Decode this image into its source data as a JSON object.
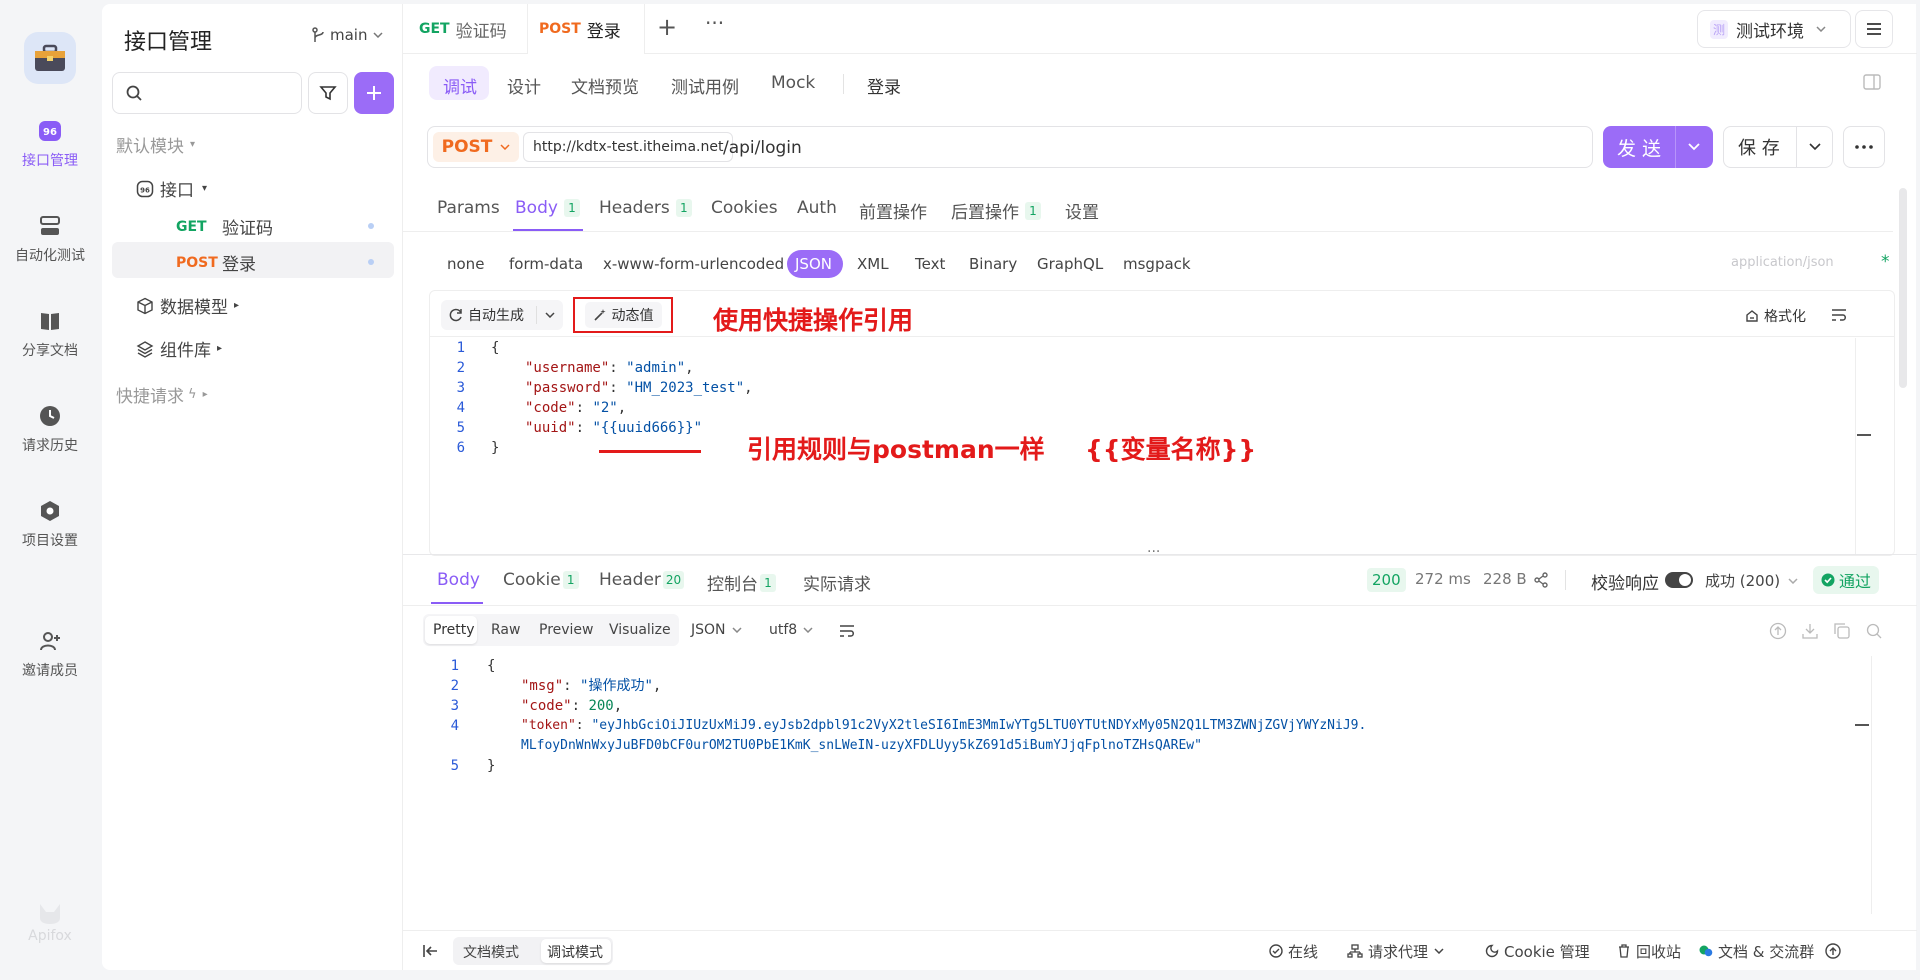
{
  "rail": {
    "brand": "Apifox",
    "items": [
      {
        "label": "接口管理",
        "icon": "api-icon"
      },
      {
        "label": "自动化测试",
        "icon": "automation-icon"
      },
      {
        "label": "分享文档",
        "icon": "book-icon"
      },
      {
        "label": "请求历史",
        "icon": "clock-icon"
      },
      {
        "label": "项目设置",
        "icon": "hexagon-settings-icon"
      },
      {
        "label": "邀请成员",
        "icon": "add-user-icon"
      }
    ]
  },
  "sidebar": {
    "title": "接口管理",
    "branch": "main",
    "search_placeholder": "",
    "tree": {
      "default_module": "默认模块",
      "folder": "接口",
      "endpoints": [
        {
          "method": "GET",
          "name": "验证码"
        },
        {
          "method": "POST",
          "name": "登录"
        }
      ],
      "data_models": "数据模型",
      "components": "组件库",
      "quick_requests": "快捷请求"
    }
  },
  "tabs": {
    "open": [
      {
        "method": "GET",
        "name": "验证码"
      },
      {
        "method": "POST",
        "name": "登录"
      }
    ],
    "add": "+",
    "more": "···"
  },
  "env": {
    "badge": "测",
    "name": "测试环境"
  },
  "subtabs": {
    "items": [
      "调试",
      "设计",
      "文档预览",
      "测试用例",
      "Mock"
    ],
    "active": "调试",
    "endpoint_name": "登录"
  },
  "request": {
    "method": "POST",
    "base_url": "http://kdtx-test.itheima.net",
    "path": "/api/login",
    "send_label": "发 送",
    "save_label": "保 存"
  },
  "param_tabs": [
    {
      "label": "Params"
    },
    {
      "label": "Body",
      "count": "1"
    },
    {
      "label": "Headers",
      "count": "1"
    },
    {
      "label": "Cookies"
    },
    {
      "label": "Auth"
    },
    {
      "label": "前置操作"
    },
    {
      "label": "后置操作",
      "count": "1"
    },
    {
      "label": "设置"
    }
  ],
  "body_types": [
    "none",
    "form-data",
    "x-www-form-urlencoded",
    "JSON",
    "XML",
    "Text",
    "Binary",
    "GraphQL",
    "msgpack"
  ],
  "body_active": "JSON",
  "content_type": "application/json",
  "required_mark": "*",
  "editor_toolbar": {
    "auto_generate": "自动生成",
    "dynamic_value": "动态值",
    "format": "格式化"
  },
  "annotations": {
    "note1": "使用快捷操作引用",
    "note2": "引用规则与postman一样",
    "note3": "{{变量名称}}",
    "color": "#e31a1a"
  },
  "request_body": {
    "line_numbers": [
      "1",
      "2",
      "3",
      "4",
      "5",
      "6"
    ],
    "open": "{",
    "close": "}",
    "fields": [
      {
        "key": "\"username\"",
        "value": "\"admin\""
      },
      {
        "key": "\"password\"",
        "value": "\"HM_2023_test\""
      },
      {
        "key": "\"code\"",
        "value": "\"2\""
      },
      {
        "key": "\"uuid\"",
        "value": "\"{{uuid666}}\""
      }
    ]
  },
  "response": {
    "tabs": [
      {
        "label": "Body"
      },
      {
        "label": "Cookie",
        "count": "1"
      },
      {
        "label": "Header",
        "count": "20"
      },
      {
        "label": "控制台",
        "count": "1"
      },
      {
        "label": "实际请求"
      }
    ],
    "status": "200",
    "time": "272 ms",
    "size": "228 B",
    "validate_label": "校验响应",
    "result": "成功 (200)",
    "pass": "通过",
    "views": [
      "Pretty",
      "Raw",
      "Preview",
      "Visualize"
    ],
    "format": "JSON",
    "encoding": "utf8",
    "line_numbers": [
      "1",
      "2",
      "3",
      "4",
      "",
      "5"
    ],
    "open": "{",
    "close": "}",
    "msg_key": "\"msg\"",
    "msg_val": "\"操作成功\"",
    "code_key": "\"code\"",
    "code_val": "200",
    "token_key": "\"token\"",
    "token_val_1": "\"eyJhbGciOiJIUzUxMiJ9.eyJsb2dpbl91c2VyX2tleSI6ImE3MmIwYTg5LTU0YTUtNDYxMy05N2Q1LTM3ZWNjZGVjYWYzNiJ9.",
    "token_val_2": "MLfoyDnWnWxyJuBFD0bCF0urOM2TU0PbE1KmK_snLWeIN-uzyXFDLUyy5kZ691d5iBumYJjqFplnoTZHsQAREw\""
  },
  "bottom": {
    "doc_mode": "文档模式",
    "debug_mode": "调试模式",
    "online": "在线",
    "proxy": "请求代理",
    "cookie": "Cookie 管理",
    "trash": "回收站",
    "community": "文档 & 交流群"
  }
}
